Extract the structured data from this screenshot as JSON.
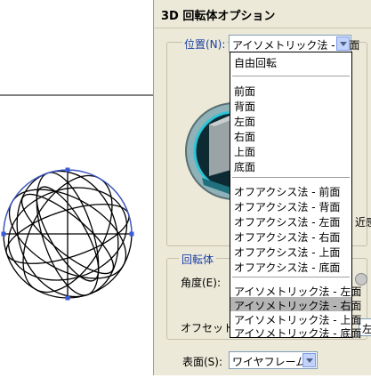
{
  "dialog": {
    "title": "3D 回転体オプション",
    "position_label": "位置(N):",
    "position_value": "アイソメトリック法 - 右面",
    "revolve_legend": "回転体",
    "angle_label": "角度(E):",
    "offset_label": "オフセット(F",
    "offset_value_fragment": "左",
    "surface_label": "表面(S):",
    "surface_value": "ワイヤフレーム",
    "perspective_fragment": "近感"
  },
  "dropdown": {
    "groups": [
      [
        "自由回転"
      ],
      [
        "前面",
        "背面",
        "左面",
        "右面",
        "上面",
        "底面"
      ],
      [
        "オフアクシス法 - 前面",
        "オフアクシス法 - 背面",
        "オフアクシス法 - 左面",
        "オフアクシス法 - 右面",
        "オフアクシス法 - 上面",
        "オフアクシス法 - 底面"
      ],
      [
        "アイソメトリック法 - 左面",
        "アイソメトリック法 - 右面",
        "アイソメトリック法 - 上面",
        "アイソメトリック法 - 底面"
      ]
    ],
    "selected": "アイソメトリック法 - 右面"
  },
  "colors": {
    "legend": "#1c3fa8",
    "dialog_bg": "#ece9d8",
    "selected_bg": "#b4b4b4",
    "path_handle": "#3b5bdb"
  }
}
